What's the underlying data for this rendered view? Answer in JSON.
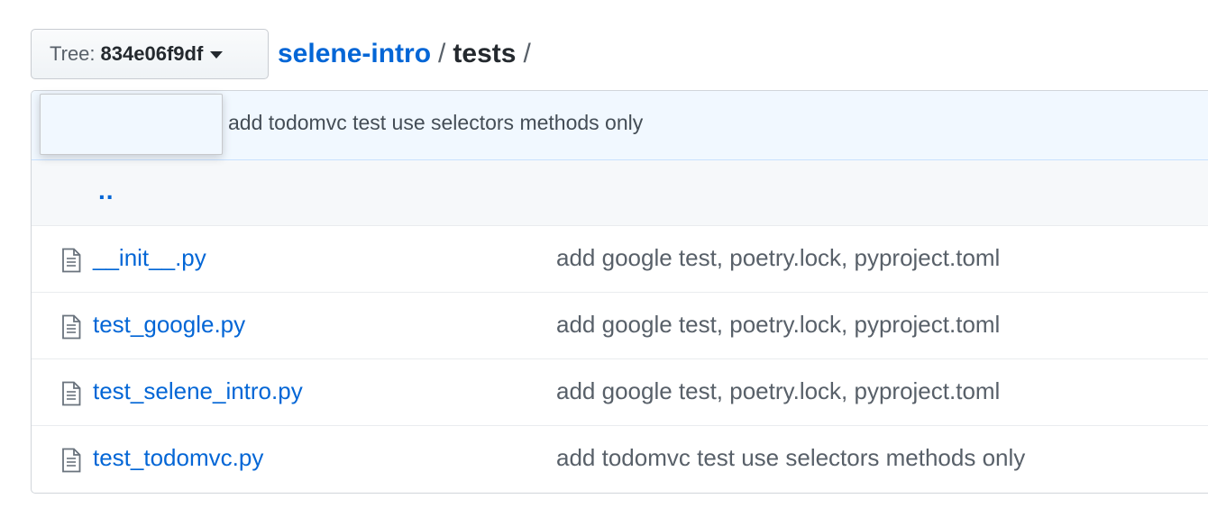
{
  "tree_button": {
    "label": "Tree:",
    "sha": "834e06f9df"
  },
  "breadcrumb": {
    "repo": "selene-intro",
    "separator": "/",
    "dir": "tests",
    "trailing": "/"
  },
  "latest_commit": {
    "message": "add todomvc test use selectors methods only"
  },
  "parent_link": "..",
  "files": [
    {
      "name": "__init__.py",
      "commit": "add google test, poetry.lock, pyproject.toml",
      "icon": "file-icon"
    },
    {
      "name": "test_google.py",
      "commit": "add google test, poetry.lock, pyproject.toml",
      "icon": "file-icon"
    },
    {
      "name": "test_selene_intro.py",
      "commit": "add google test, poetry.lock, pyproject.toml",
      "icon": "file-icon"
    },
    {
      "name": "test_todomvc.py",
      "commit": "add todomvc test use selectors methods only",
      "icon": "file-icon"
    }
  ],
  "colors": {
    "link": "#0366d6",
    "commit_bg": "#f1f8ff",
    "border": "#d1d5da"
  }
}
